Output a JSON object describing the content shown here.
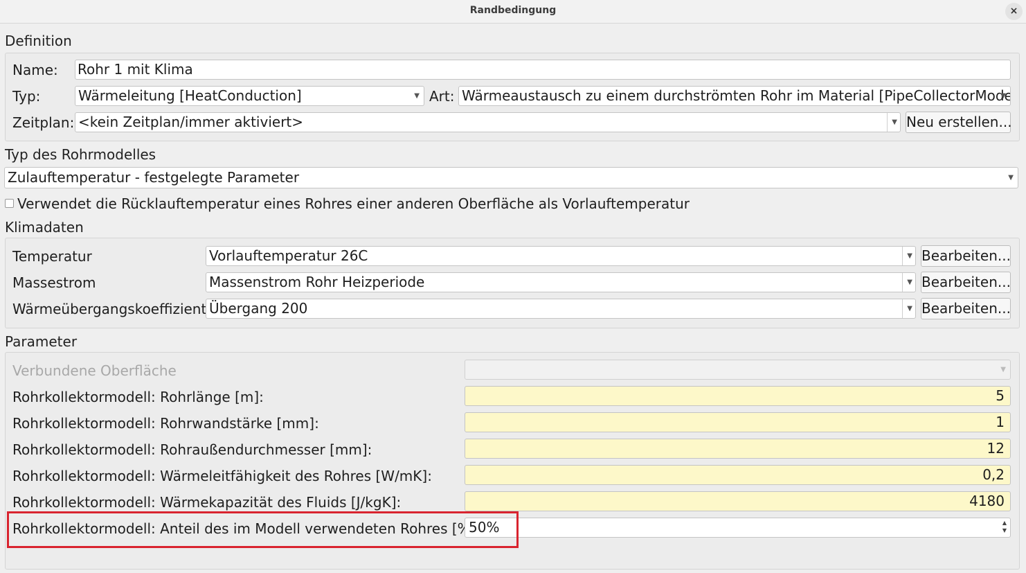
{
  "window": {
    "title": "Randbedingung",
    "close_icon": "×"
  },
  "definition": {
    "title": "Definition",
    "name_label": "Name:",
    "name_value": "Rohr 1 mit Klima",
    "typ_label": "Typ:",
    "typ_value": "Wärmeleitung [HeatConduction]",
    "art_label": "Art:",
    "art_value": "Wärmeaustausch zu einem durchströmten Rohr im Material [PipeCollectorModel]",
    "zeitplan_label": "Zeitplan:",
    "zeitplan_value": "<kein Zeitplan/immer aktiviert>",
    "new_button": "Neu erstellen..."
  },
  "pipe_model": {
    "title": "Typ des Rohrmodelles",
    "value": "Zulauftemperatur - festgelegte Parameter",
    "checkbox_label": "Verwendet die Rücklauftemperatur eines Rohres einer anderen Oberfläche als Vorlauftemperatur",
    "checkbox_checked": false
  },
  "climate": {
    "title": "Klimadaten",
    "rows": [
      {
        "label": "Temperatur",
        "value": "Vorlauftemperatur 26C",
        "button": "Bearbeiten..."
      },
      {
        "label": "Massestrom",
        "value": "Massenstrom Rohr Heizperiode",
        "button": "Bearbeiten..."
      },
      {
        "label": "Wärmeübergangskoeffizient",
        "value": "Übergang 200",
        "button": "Bearbeiten..."
      }
    ]
  },
  "parameters": {
    "title": "Parameter",
    "connected_surface_label": "Verbundene Oberfläche",
    "connected_surface_value": "",
    "rows": [
      {
        "label": "Rohrkollektormodell: Rohrlänge [m]:",
        "value": "5"
      },
      {
        "label": "Rohrkollektormodell: Rohrwandstärke [mm]:",
        "value": "1"
      },
      {
        "label": "Rohrkollektormodell: Rohraußendurchmesser [mm]:",
        "value": "12"
      },
      {
        "label": "Rohrkollektormodell: Wärmeleitfähigkeit des Rohres [W/mK]:",
        "value": "0,2"
      },
      {
        "label": "Rohrkollektormodell: Wärmekapazität des Fluids [J/kgK]:",
        "value": "4180"
      }
    ],
    "share_label": "Rohrkollektormodell: Anteil des im Modell verwendeten Rohres [%]:",
    "share_value": "50%"
  },
  "colors": {
    "highlight": "#d9242f",
    "editable_field": "#fdf8c9"
  }
}
